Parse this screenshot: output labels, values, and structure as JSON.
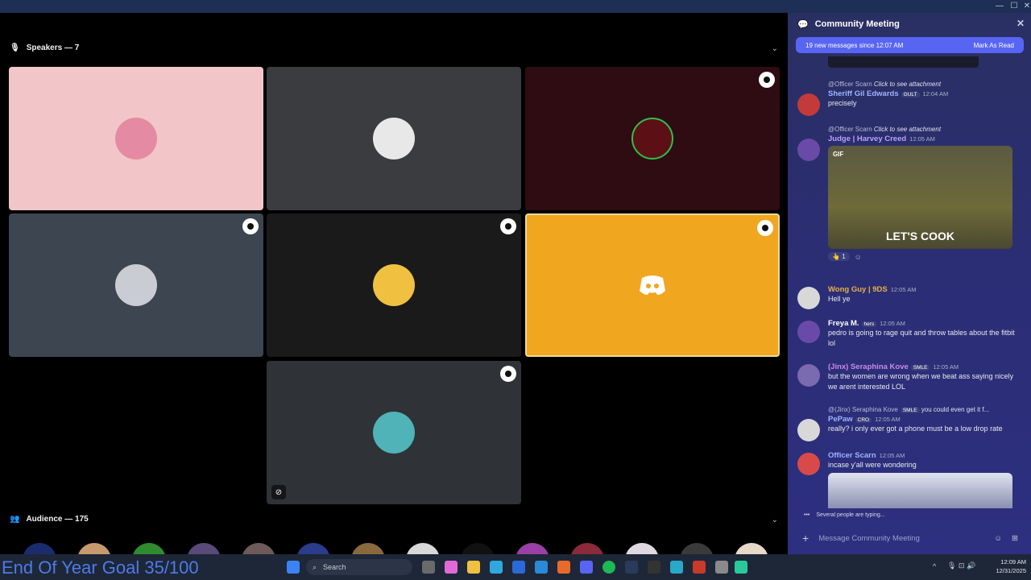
{
  "stage": {
    "speakers_label": "Speakers — 7",
    "audience_label": "Audience — 175",
    "accent": "#f0a61e"
  },
  "chat": {
    "title": "Community Meeting",
    "new_messages": "19 new messages since 12:07 AM",
    "mark_as_read": "Mark As Read",
    "messages": [
      {
        "reply_user": "@Officer Scarn",
        "reply_text": "Click to see attachment",
        "user": "Sheriff Gil Edwards",
        "tag": "GULT",
        "time": "12:04 AM",
        "text": "precisely"
      },
      {
        "reply_user": "@Officer Scarn",
        "reply_text": "Click to see attachment",
        "user": "Judge | Harvey Creed",
        "time": "12:05 AM",
        "gif_label": "GIF",
        "gif_caption": "LET'S COOK",
        "reaction_count": "1"
      },
      {
        "user": "Wong Guy | 9DS",
        "time": "12:05 AM",
        "text": "Hell ye"
      },
      {
        "user": "Freya M.",
        "tag": "hers",
        "time": "12:05 AM",
        "text": "pedro is going to rage quit and throw tables about the fitbit lol"
      },
      {
        "user": "(Jinx) Seraphina Kove",
        "tag": "SMLE",
        "time": "12:05 AM",
        "text": "but the women are wrong when we beat ass saying nicely we arent interested LOL"
      },
      {
        "reply_user": "@(Jinx) Seraphina Kove",
        "reply_tag": "SMLE",
        "reply_text": "you could even get it f...",
        "user": "PePaw",
        "tag": "CRO",
        "time": "12:05 AM",
        "text": "really? i only ever got a phone must be a low drop rate"
      },
      {
        "user": "Officer Scarn",
        "time": "12:05 AM",
        "text": "incase y'all were wondering"
      }
    ],
    "typing": "Several people are typing...",
    "composer_placeholder": "Message Community Meeting"
  },
  "overlay": {
    "goal": "End Of Year Goal 35/100"
  },
  "taskbar": {
    "search": "Search",
    "time": "12:09 AM",
    "date": "12/31/2025"
  }
}
